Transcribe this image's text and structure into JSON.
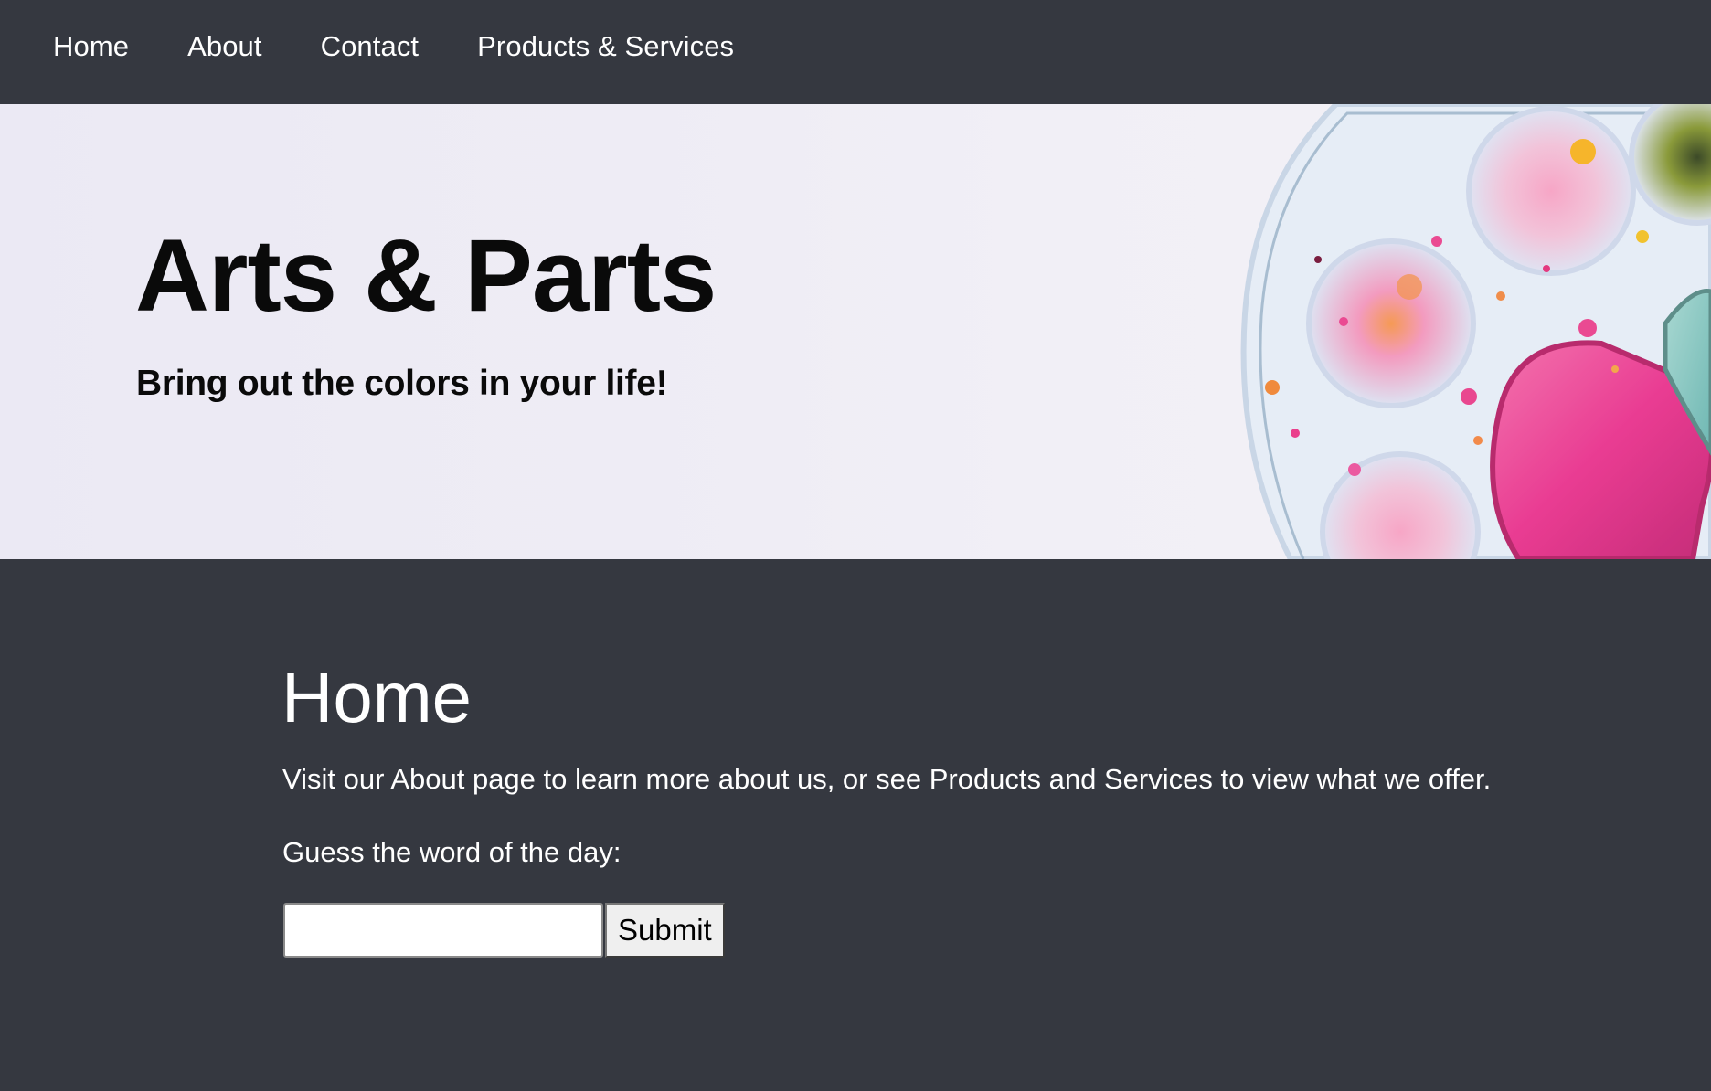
{
  "nav": {
    "items": [
      {
        "label": "Home"
      },
      {
        "label": "About"
      },
      {
        "label": "Contact"
      },
      {
        "label": "Products & Services"
      }
    ]
  },
  "hero": {
    "title": "Arts & Parts",
    "tagline": "Bring out the colors in your life!"
  },
  "main": {
    "heading": "Home",
    "intro": "Visit our About page to learn more about us, or see Products and Services to view what we offer.",
    "guess_label": "Guess the word of the day:",
    "guess_input": {
      "value": "",
      "placeholder": ""
    },
    "submit_label": "Submit"
  },
  "colors": {
    "nav_background": "#353840",
    "main_background": "#353840",
    "hero_background": "#eeecf5",
    "text_light": "#ffffff",
    "text_dark": "#0a0a0a"
  }
}
